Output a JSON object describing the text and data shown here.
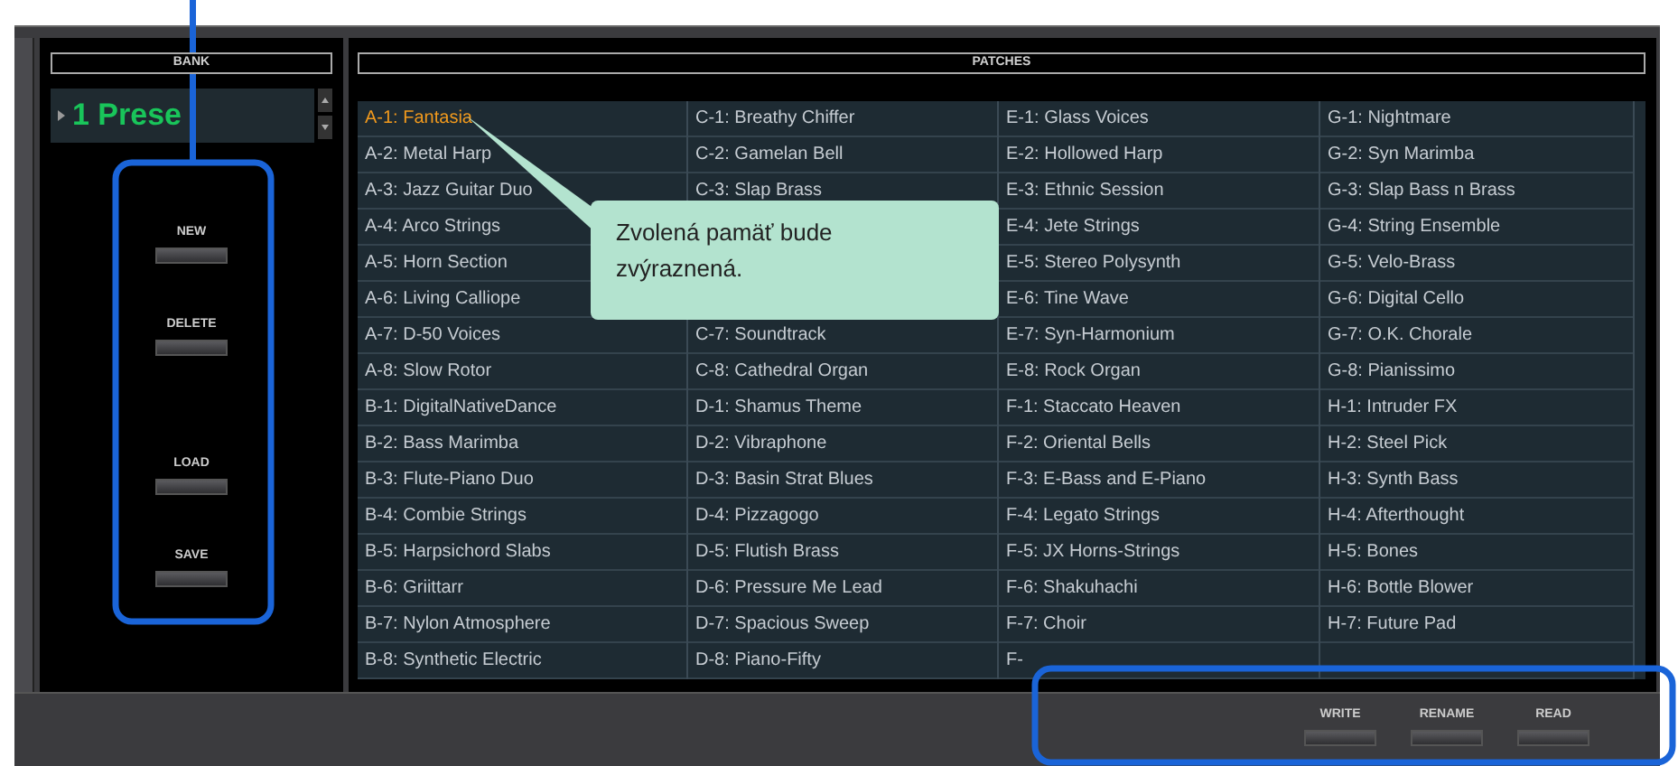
{
  "bank": {
    "header": "BANK",
    "preset": "1 Prese"
  },
  "bank_buttons": [
    {
      "label": "NEW"
    },
    {
      "label": "DELETE"
    },
    {
      "label": "LOAD"
    },
    {
      "label": "SAVE"
    }
  ],
  "patches": {
    "header": "PATCHES",
    "columns": [
      [
        {
          "text": "A-1: Fantasia",
          "selected": true
        },
        {
          "text": "A-2: Metal Harp",
          "selected": false
        },
        {
          "text": "A-3: Jazz Guitar Duo",
          "selected": false
        },
        {
          "text": "A-4: Arco Strings",
          "selected": false
        },
        {
          "text": "A-5: Horn Section",
          "selected": false
        },
        {
          "text": "A-6: Living Calliope",
          "selected": false
        },
        {
          "text": "A-7: D-50 Voices",
          "selected": false
        },
        {
          "text": "A-8: Slow Rotor",
          "selected": false
        },
        {
          "text": "B-1: DigitalNativeDance",
          "selected": false
        },
        {
          "text": "B-2: Bass Marimba",
          "selected": false
        },
        {
          "text": "B-3: Flute-Piano Duo",
          "selected": false
        },
        {
          "text": "B-4: Combie Strings",
          "selected": false
        },
        {
          "text": "B-5: Harpsichord Slabs",
          "selected": false
        },
        {
          "text": "B-6: Griittarr",
          "selected": false
        },
        {
          "text": "B-7: Nylon Atmosphere",
          "selected": false
        },
        {
          "text": "B-8: Synthetic Electric",
          "selected": false
        }
      ],
      [
        {
          "text": "C-1: Breathy Chiffer",
          "selected": false
        },
        {
          "text": "C-2: Gamelan Bell",
          "selected": false
        },
        {
          "text": "C-3: Slap Brass",
          "selected": false
        },
        {},
        {},
        {},
        {
          "text": "C-7: Soundtrack",
          "selected": false
        },
        {
          "text": "C-8: Cathedral Organ",
          "selected": false
        },
        {
          "text": "D-1: Shamus Theme",
          "selected": false
        },
        {
          "text": "D-2: Vibraphone",
          "selected": false
        },
        {
          "text": "D-3: Basin Strat Blues",
          "selected": false
        },
        {
          "text": "D-4: Pizzagogo",
          "selected": false
        },
        {
          "text": "D-5: Flutish Brass",
          "selected": false
        },
        {
          "text": "D-6: Pressure Me Lead",
          "selected": false
        },
        {
          "text": "D-7: Spacious Sweep",
          "selected": false
        },
        {
          "text": "D-8: Piano-Fifty",
          "selected": false
        }
      ],
      [
        {
          "text": "E-1: Glass Voices",
          "selected": false
        },
        {
          "text": "E-2: Hollowed Harp",
          "selected": false
        },
        {
          "text": "E-3: Ethnic Session",
          "selected": false
        },
        {
          "text": "E-4: Jete Strings",
          "selected": false
        },
        {
          "text": "E-5: Stereo Polysynth",
          "selected": false
        },
        {
          "text": "E-6: Tine Wave",
          "selected": false
        },
        {
          "text": "E-7: Syn-Harmonium",
          "selected": false
        },
        {
          "text": "E-8: Rock Organ",
          "selected": false
        },
        {
          "text": "F-1: Staccato Heaven",
          "selected": false
        },
        {
          "text": "F-2: Oriental Bells",
          "selected": false
        },
        {
          "text": "F-3: E-Bass and E-Piano",
          "selected": false
        },
        {
          "text": "F-4: Legato Strings",
          "selected": false
        },
        {
          "text": "F-5: JX Horns-Strings",
          "selected": false
        },
        {
          "text": "F-6: Shakuhachi",
          "selected": false
        },
        {
          "text": "F-7: Choir",
          "selected": false
        },
        {
          "text": "F-",
          "selected": false
        }
      ],
      [
        {
          "text": "G-1: Nightmare",
          "selected": false
        },
        {
          "text": "G-2: Syn Marimba",
          "selected": false
        },
        {
          "text": "G-3: Slap Bass n Brass",
          "selected": false
        },
        {
          "text": "G-4: String Ensemble",
          "selected": false
        },
        {
          "text": "G-5: Velo-Brass",
          "selected": false
        },
        {
          "text": "G-6: Digital Cello",
          "selected": false
        },
        {
          "text": "G-7: O.K. Chorale",
          "selected": false
        },
        {
          "text": "G-8: Pianissimo",
          "selected": false
        },
        {
          "text": "H-1: Intruder FX",
          "selected": false
        },
        {
          "text": "H-2: Steel Pick",
          "selected": false
        },
        {
          "text": "H-3: Synth Bass",
          "selected": false
        },
        {
          "text": "H-4: Afterthought",
          "selected": false
        },
        {
          "text": "H-5: Bones",
          "selected": false
        },
        {
          "text": "H-6: Bottle Blower",
          "selected": false
        },
        {
          "text": "H-7: Future Pad",
          "selected": false
        },
        {}
      ]
    ]
  },
  "bottom_buttons": [
    {
      "label": "WRITE"
    },
    {
      "label": "RENAME"
    },
    {
      "label": "READ"
    }
  ],
  "callout": "Zvolená pamäť bude zvýraznená."
}
